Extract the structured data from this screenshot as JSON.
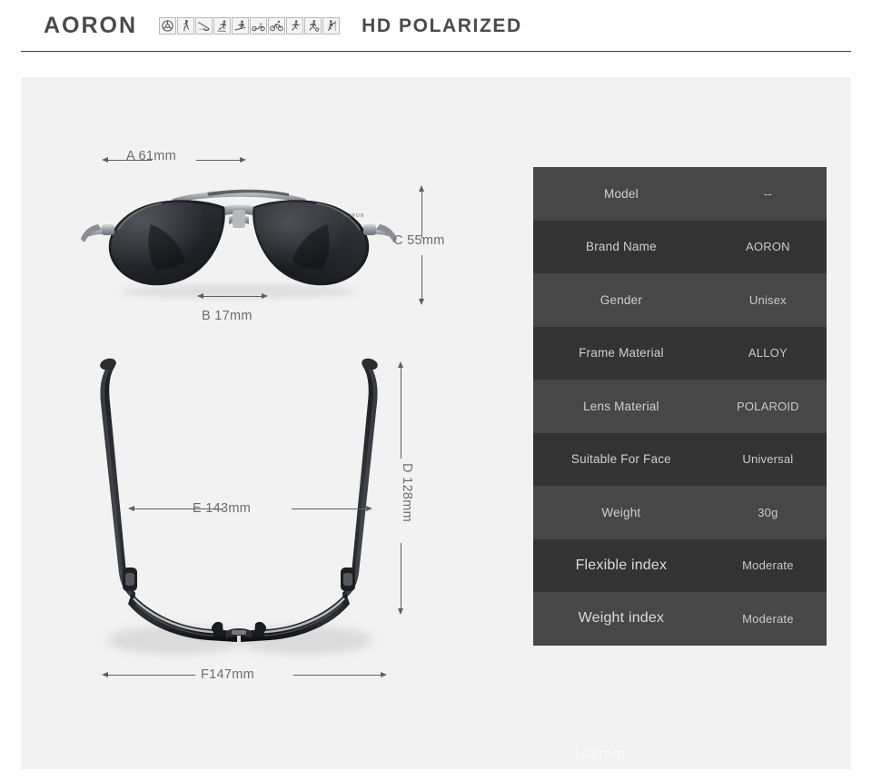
{
  "header": {
    "brand": "AORON",
    "tagline": "HD POLARIZED",
    "sport_icons": [
      {
        "name": "steering-wheel-icon"
      },
      {
        "name": "golf-icon"
      },
      {
        "name": "fishing-icon"
      },
      {
        "name": "skating-icon"
      },
      {
        "name": "skiing-icon"
      },
      {
        "name": "motorcycle-icon"
      },
      {
        "name": "cycling-icon"
      },
      {
        "name": "running-icon"
      },
      {
        "name": "soccer-icon"
      },
      {
        "name": "climbing-icon"
      }
    ]
  },
  "watermarks": {
    "top": "61mm",
    "bottom": "148mm"
  },
  "dimensions": {
    "a": "A 61mm",
    "b": "B 17mm",
    "c": "C 55mm",
    "d": "D 128mm",
    "e": "E 143mm",
    "f": "F147mm"
  },
  "spec_table": {
    "rows": [
      {
        "label": "Model",
        "value": "--"
      },
      {
        "label": "Brand Name",
        "value": "AORON"
      },
      {
        "label": "Gender",
        "value": "Unisex"
      },
      {
        "label": "Frame Material",
        "value": "ALLOY"
      },
      {
        "label": "Lens Material",
        "value": "POLAROID"
      },
      {
        "label": "Suitable For Face",
        "value": "Universal"
      },
      {
        "label": "Weight",
        "value": "30g"
      },
      {
        "label": "Flexible index",
        "value": "Moderate"
      },
      {
        "label": "Weight index",
        "value": "Moderate"
      }
    ]
  },
  "colors": {
    "page_background": "#ffffff",
    "panel_background": "#f2f2f2",
    "header_text": "#4a4a4a",
    "rule": "#3a3a3a",
    "dimension_text": "#6d6d6d",
    "table_row_odd": "#474747",
    "table_row_even": "#333333",
    "table_label_text": "#cfcfcf"
  }
}
